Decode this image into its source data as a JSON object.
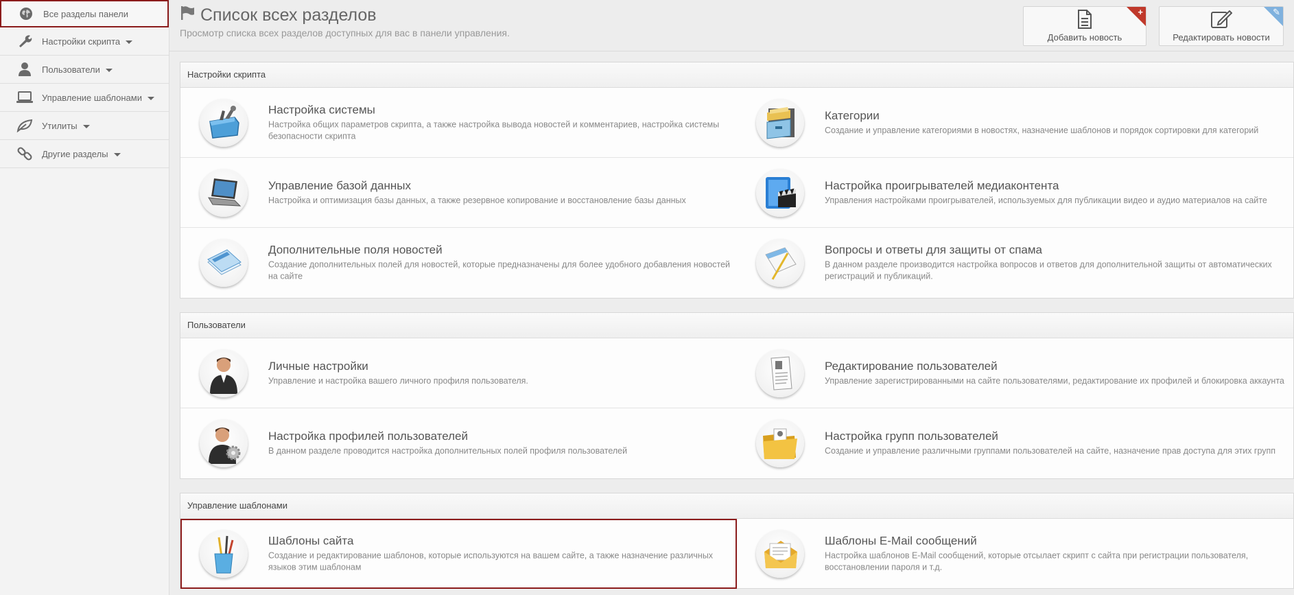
{
  "sidebar": {
    "items": [
      {
        "label": "Все разделы панели",
        "icon": "globe-icon"
      },
      {
        "label": "Настройки скрипта",
        "icon": "wrench-icon"
      },
      {
        "label": "Пользователи",
        "icon": "user-icon"
      },
      {
        "label": "Управление шаблонами",
        "icon": "laptop-icon"
      },
      {
        "label": "Утилиты",
        "icon": "leaf-icon"
      },
      {
        "label": "Другие разделы",
        "icon": "link-icon"
      }
    ]
  },
  "header": {
    "title": "Список всех разделов",
    "subtitle": "Просмотр списка всех разделов доступных для вас в панели управления.",
    "add_news": "Добавить новость",
    "edit_news": "Редактировать новости"
  },
  "sections": [
    {
      "title": "Настройки скрипта",
      "items": [
        {
          "title": "Настройка системы",
          "desc": "Настройка общих параметров скрипта, а также настройка вывода новостей и комментариев, настройка системы безопасности скрипта",
          "icon": "toolbox-icon"
        },
        {
          "title": "Категории",
          "desc": "Создание и управление категориями в новостях, назначение шаблонов и порядок сортировки для категорий",
          "icon": "file-cabinet-icon"
        },
        {
          "title": "Управление базой данных",
          "desc": "Настройка и оптимизация базы данных, а также резервное копирование и восстановление базы данных",
          "icon": "laptop-icon"
        },
        {
          "title": "Настройка проигрывателей медиаконтента",
          "desc": "Управления настройками проигрывателей, используемых для публикации видео и аудио материалов на сайте",
          "icon": "media-player-icon"
        },
        {
          "title": "Дополнительные поля новостей",
          "desc": "Создание дополнительных полей для новостей, которые предназначены для более удобного добавления новостей на сайте",
          "icon": "papers-icon"
        },
        {
          "title": "Вопросы и ответы для защиты от спама",
          "desc": "В данном разделе производится настройка вопросов и ответов для дополнительной защиты от автоматических регистраций и публикаций.",
          "icon": "notepad-icon"
        }
      ]
    },
    {
      "title": "Пользователи",
      "items": [
        {
          "title": "Личные настройки",
          "desc": "Управление и настройка вашего личного профиля пользователя.",
          "icon": "person-icon"
        },
        {
          "title": "Редактирование пользователей",
          "desc": "Управление зарегистрированными на сайте пользователями, редактирование их профилей и блокировка аккаунта",
          "icon": "document-icon"
        },
        {
          "title": "Настройка профилей пользователей",
          "desc": "В данном разделе проводится настройка дополнительных полей профиля пользователей",
          "icon": "person-gear-icon"
        },
        {
          "title": "Настройка групп пользователей",
          "desc": "Создание и управление различными группами пользователей на сайте, назначение прав доступа для этих групп",
          "icon": "folder-icon"
        }
      ]
    },
    {
      "title": "Управление шаблонами",
      "items": [
        {
          "title": "Шаблоны сайта",
          "desc": "Создание и редактирование шаблонов, которые используются на вашем сайте, а также назначение различных языков этим шаблонам",
          "icon": "pencil-cup-icon"
        },
        {
          "title": "Шаблоны E-Mail сообщений",
          "desc": "Настройка шаблонов E-Mail сообщений, которые отсылает скрипт с сайта при регистрации пользователя, восстановлении пароля и т.д.",
          "icon": "envelope-icon"
        }
      ]
    }
  ]
}
